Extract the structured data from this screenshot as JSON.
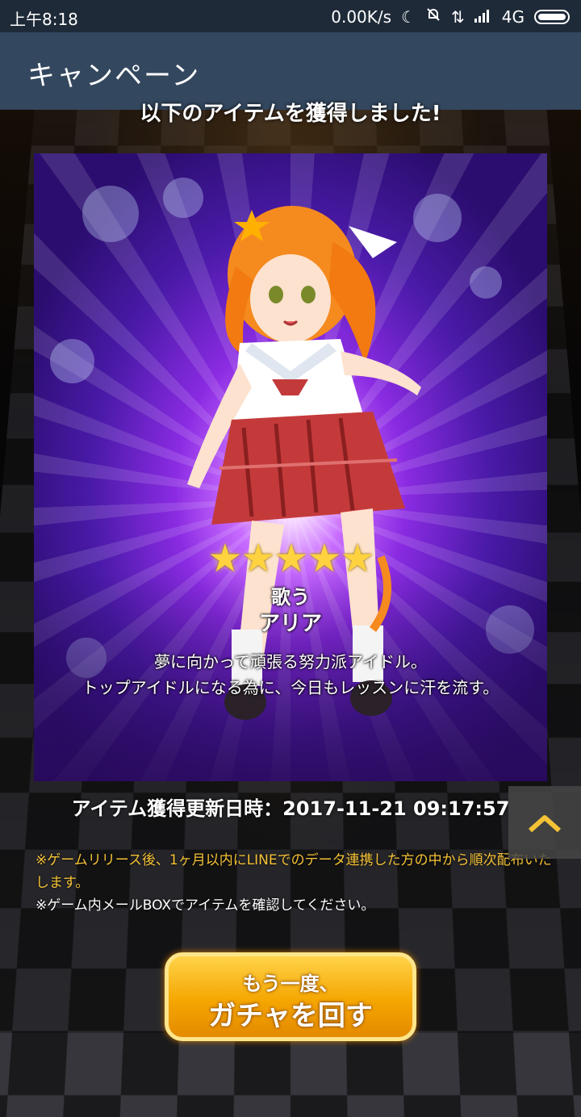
{
  "status_bar": {
    "time": "上午8:18",
    "net_speed": "0.00K/s",
    "network": "4G",
    "icons": [
      "moon-icon",
      "mute-icon",
      "data-arrows-icon",
      "signal-icon",
      "battery-icon"
    ]
  },
  "app_bar": {
    "title": "キャンペーン"
  },
  "acquired_message": "以下のアイテムを獲得しました!",
  "card": {
    "rarity_stars": "★★★★★",
    "type": "歌う",
    "name": "アリア",
    "description_lines": [
      "夢に向かって頑張る努力派アイドル。",
      "トップアイドルになる為に、今日もレッスンに汗を流す。"
    ]
  },
  "acquired_date": "アイテム獲得更新日時：2017-11-21 09:17:57",
  "notes": [
    "※ゲームリリース後、1ヶ月以内にLINEでのデータ連携した方の中から順次配布いたします。",
    "※ゲーム内メールBOXでアイテムを確認してください。"
  ],
  "gacha_button": {
    "line1": "もう一度、",
    "line2": "ガチャを回す"
  },
  "colors": {
    "app_bar": "#33475e",
    "status_bar": "#1e2a38",
    "note_highlight": "#f5c236",
    "button": "#f5a600"
  }
}
